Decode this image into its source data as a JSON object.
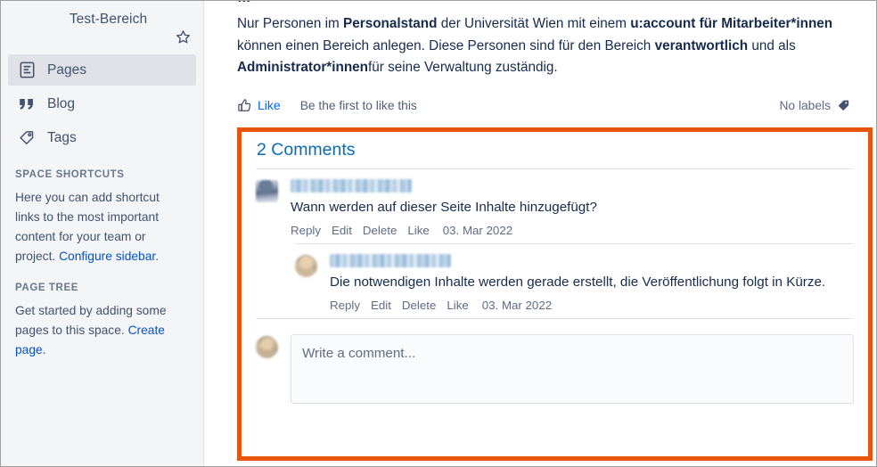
{
  "sidebar": {
    "space_title": "Test-Bereich",
    "star_icon": "star-outline-icon",
    "nav": [
      {
        "label": "Pages",
        "icon": "page-icon",
        "active": true
      },
      {
        "label": "Blog",
        "icon": "quote-icon",
        "active": false
      },
      {
        "label": "Tags",
        "icon": "tag-icon",
        "active": false
      }
    ],
    "shortcuts": {
      "heading": "SPACE SHORTCUTS",
      "text_before": "Here you can add shortcut links to the most important content for your team or project. ",
      "link": "Configure sidebar",
      "text_after": "."
    },
    "page_tree": {
      "heading": "PAGE TREE",
      "text_before": "Get started by adding some pages to this space. ",
      "link": "Create page",
      "text_after": "."
    },
    "resize_handle": "sidebar-resize-handle"
  },
  "main": {
    "clipped_line": "…",
    "paragraph": {
      "p1": "Nur Personen im ",
      "b1": "Personalstand",
      "p2": " der Universität Wien mit einem ",
      "b2": "u:account für Mitarbeiter*innen",
      "p3": " können einen Bereich anlegen. Diese Personen sind für den Bereich ",
      "b3": "verantwortlich",
      "p4": " und als ",
      "b4": "Administrator*innen",
      "p5": "für seine Verwaltung zuständig."
    },
    "like_row": {
      "like_label": "Like",
      "like_icon": "thumbs-up-icon",
      "like_note": "Be the first to like this",
      "labels_label": "No labels",
      "labels_icon": "tag-icon"
    }
  },
  "comments": {
    "title": "2 Comments",
    "highlight_color": "#e8540c",
    "items": [
      {
        "author": "redacted-author-name",
        "text": "Wann werden auf dieser Seite Inhalte hinzugefügt?",
        "actions": [
          "Reply",
          "Edit",
          "Delete",
          "Like"
        ],
        "date": "03. Mar 2022",
        "nested": false
      },
      {
        "author": "redacted-author-name",
        "text": "Die notwendigen Inhalte werden gerade erstellt, die Veröffentlichung folgt in Kürze.",
        "actions": [
          "Reply",
          "Edit",
          "Delete",
          "Like"
        ],
        "date": "03. Mar 2022",
        "nested": true
      }
    ],
    "new_comment": {
      "placeholder": "Write a comment...",
      "value": ""
    }
  }
}
